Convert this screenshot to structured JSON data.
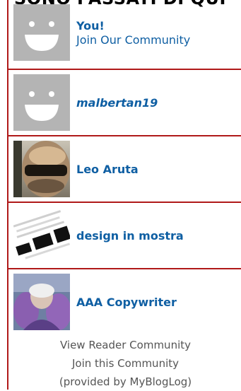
{
  "widget": {
    "title": "SONO PASSATI DI QUI",
    "members": [
      {
        "name": "You!",
        "subtitle": "Join Our Community",
        "avatar": "default-smiley-avatar"
      },
      {
        "name": "malbertan19",
        "avatar": "default-smiley-avatar"
      },
      {
        "name": "Leo Aruta",
        "avatar": "photo-avatar-leo-aruta"
      },
      {
        "name": "design in mostra",
        "avatar": "logo-avatar-design-in-mostra"
      },
      {
        "name": "AAA Copywriter",
        "avatar": "photo-avatar-aaa-copywriter"
      }
    ],
    "footer": {
      "view_link": "View Reader Community",
      "join_link": "Join this Community",
      "provided_by": "(provided by MyBlogLog)"
    },
    "colors": {
      "accent": "#b01919",
      "link": "#0f5fa3",
      "muted": "#555555",
      "avatar_gray": "#b4b4b4"
    }
  }
}
